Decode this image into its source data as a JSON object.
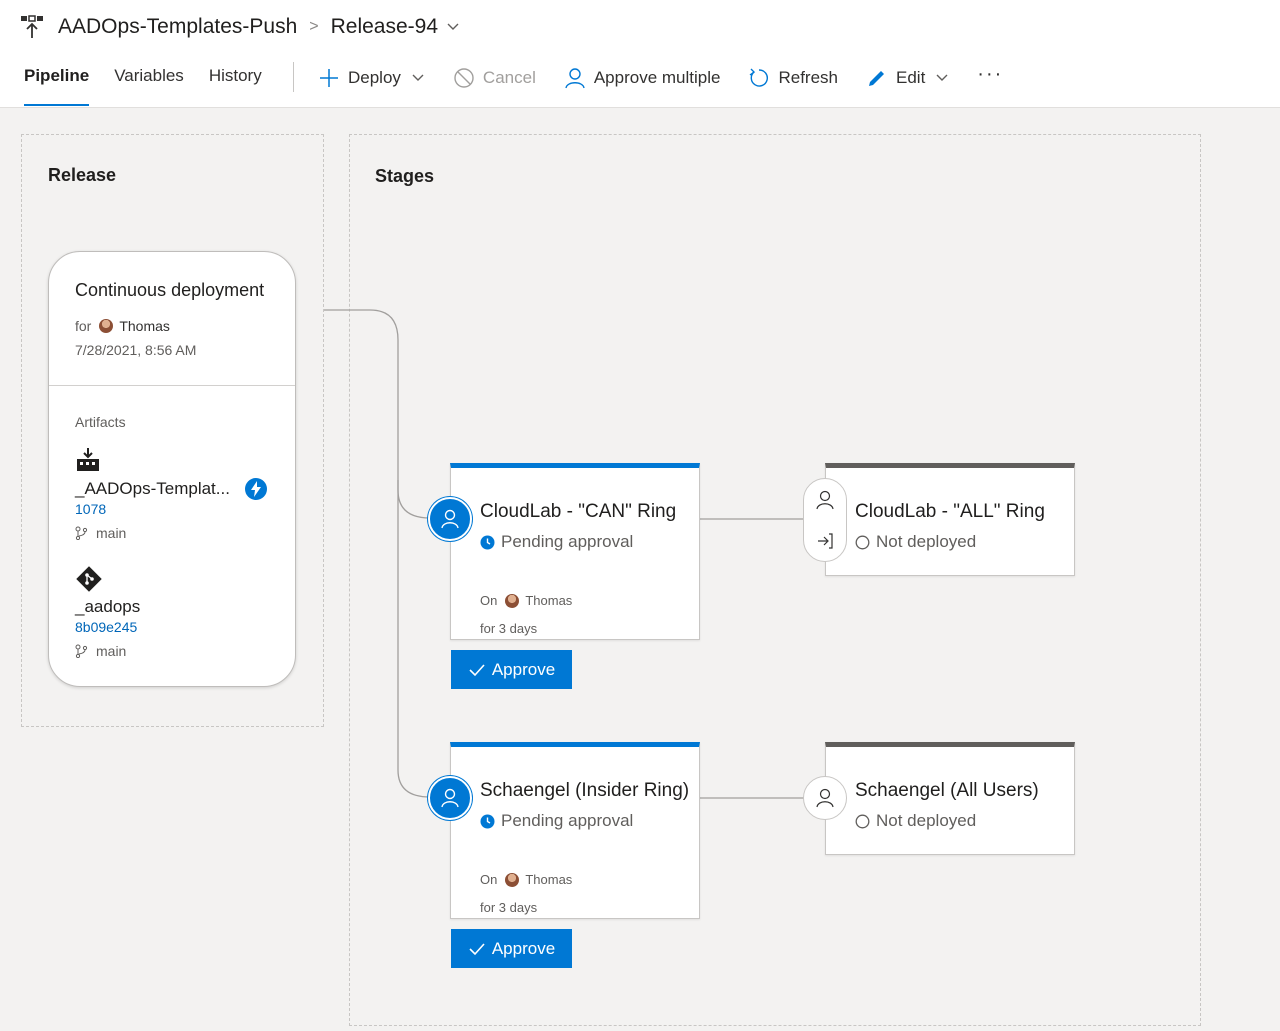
{
  "header": {
    "pipeline_title": "AADOps-Templates-Push",
    "release_name": "Release-94"
  },
  "tabs": [
    {
      "label": "Pipeline",
      "active": true
    },
    {
      "label": "Variables",
      "active": false
    },
    {
      "label": "History",
      "active": false
    }
  ],
  "toolbar": {
    "deploy_label": "Deploy",
    "cancel_label": "Cancel",
    "approve_multiple_label": "Approve multiple",
    "refresh_label": "Refresh",
    "edit_label": "Edit",
    "more_label": "···"
  },
  "release_panel": {
    "title": "Release",
    "trigger": "Continuous deployment",
    "for_label": "for",
    "user": "Thomas",
    "timestamp": "7/28/2021, 8:56 AM",
    "artifacts_label": "Artifacts",
    "artifacts": [
      {
        "name": "_AADOps-Templat...",
        "version": "1078",
        "branch": "main",
        "icon": "build-artifact-icon"
      },
      {
        "name": "_aadops",
        "version": "8b09e245",
        "branch": "main",
        "icon": "git-icon"
      }
    ]
  },
  "stages_panel": {
    "title": "Stages",
    "stages": [
      {
        "name": "CloudLab - \"CAN\" Ring",
        "status": "Pending approval",
        "on_label": "On",
        "user": "Thomas",
        "duration": "for 3 days",
        "approve_label": "Approve"
      },
      {
        "name": "CloudLab - \"ALL\" Ring",
        "status": "Not deployed"
      },
      {
        "name": "Schaengel (Insider Ring)",
        "status": "Pending approval",
        "on_label": "On",
        "user": "Thomas",
        "duration": "for 3 days",
        "approve_label": "Approve"
      },
      {
        "name": "Schaengel (All Users)",
        "status": "Not deployed"
      }
    ]
  },
  "colors": {
    "accent": "#0078d4",
    "not_deployed_bar": "#605e5c",
    "background": "#f3f2f1"
  }
}
